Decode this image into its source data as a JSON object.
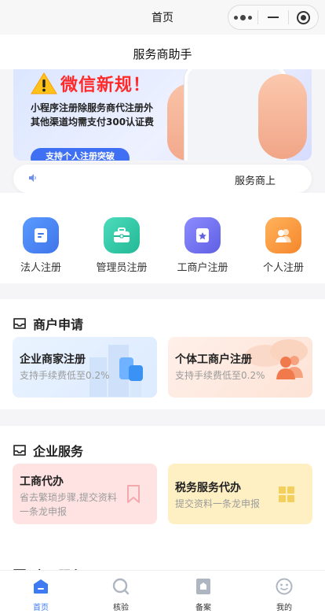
{
  "navbar": {
    "title": "首页"
  },
  "header": {
    "title": "服务商助手"
  },
  "banner": {
    "headline": "微信新规！",
    "line1": "小程序注册除服务商代注册外",
    "line2": "其他渠道均需支付300认证费",
    "button": "支持个人注册突破"
  },
  "notice": {
    "text": "服务商上"
  },
  "quick_nav": [
    {
      "label": "法人注册",
      "icon": "document-icon",
      "color": "#4a8af4"
    },
    {
      "label": "管理员注册",
      "icon": "briefcase-icon",
      "color": "#2ec9a9"
    },
    {
      "label": "工商户注册",
      "icon": "badge-icon",
      "color": "#6f6ef0"
    },
    {
      "label": "个人注册",
      "icon": "people-icon",
      "color": "#f8963f"
    }
  ],
  "merchant": {
    "title": "商户申请",
    "cards": [
      {
        "title": "企业商家注册",
        "subtitle": "支持手续费低至0.2%"
      },
      {
        "title": "个体工商户注册",
        "subtitle": "支持手续费低至0.2%"
      }
    ]
  },
  "enterprise": {
    "title": "企业服务",
    "cards": [
      {
        "title": "工商代办",
        "line1": "省去繁琐步骤,提交资料",
        "line2": "一条龙申报"
      },
      {
        "title": "税务服务代办",
        "line1": "提交资料一条龙申报"
      }
    ]
  },
  "next_section": {
    "title": "应用服务"
  },
  "tabbar": [
    {
      "label": "首页",
      "active": true
    },
    {
      "label": "核验",
      "active": false
    },
    {
      "label": "备案",
      "active": false
    },
    {
      "label": "我的",
      "active": false
    }
  ]
}
